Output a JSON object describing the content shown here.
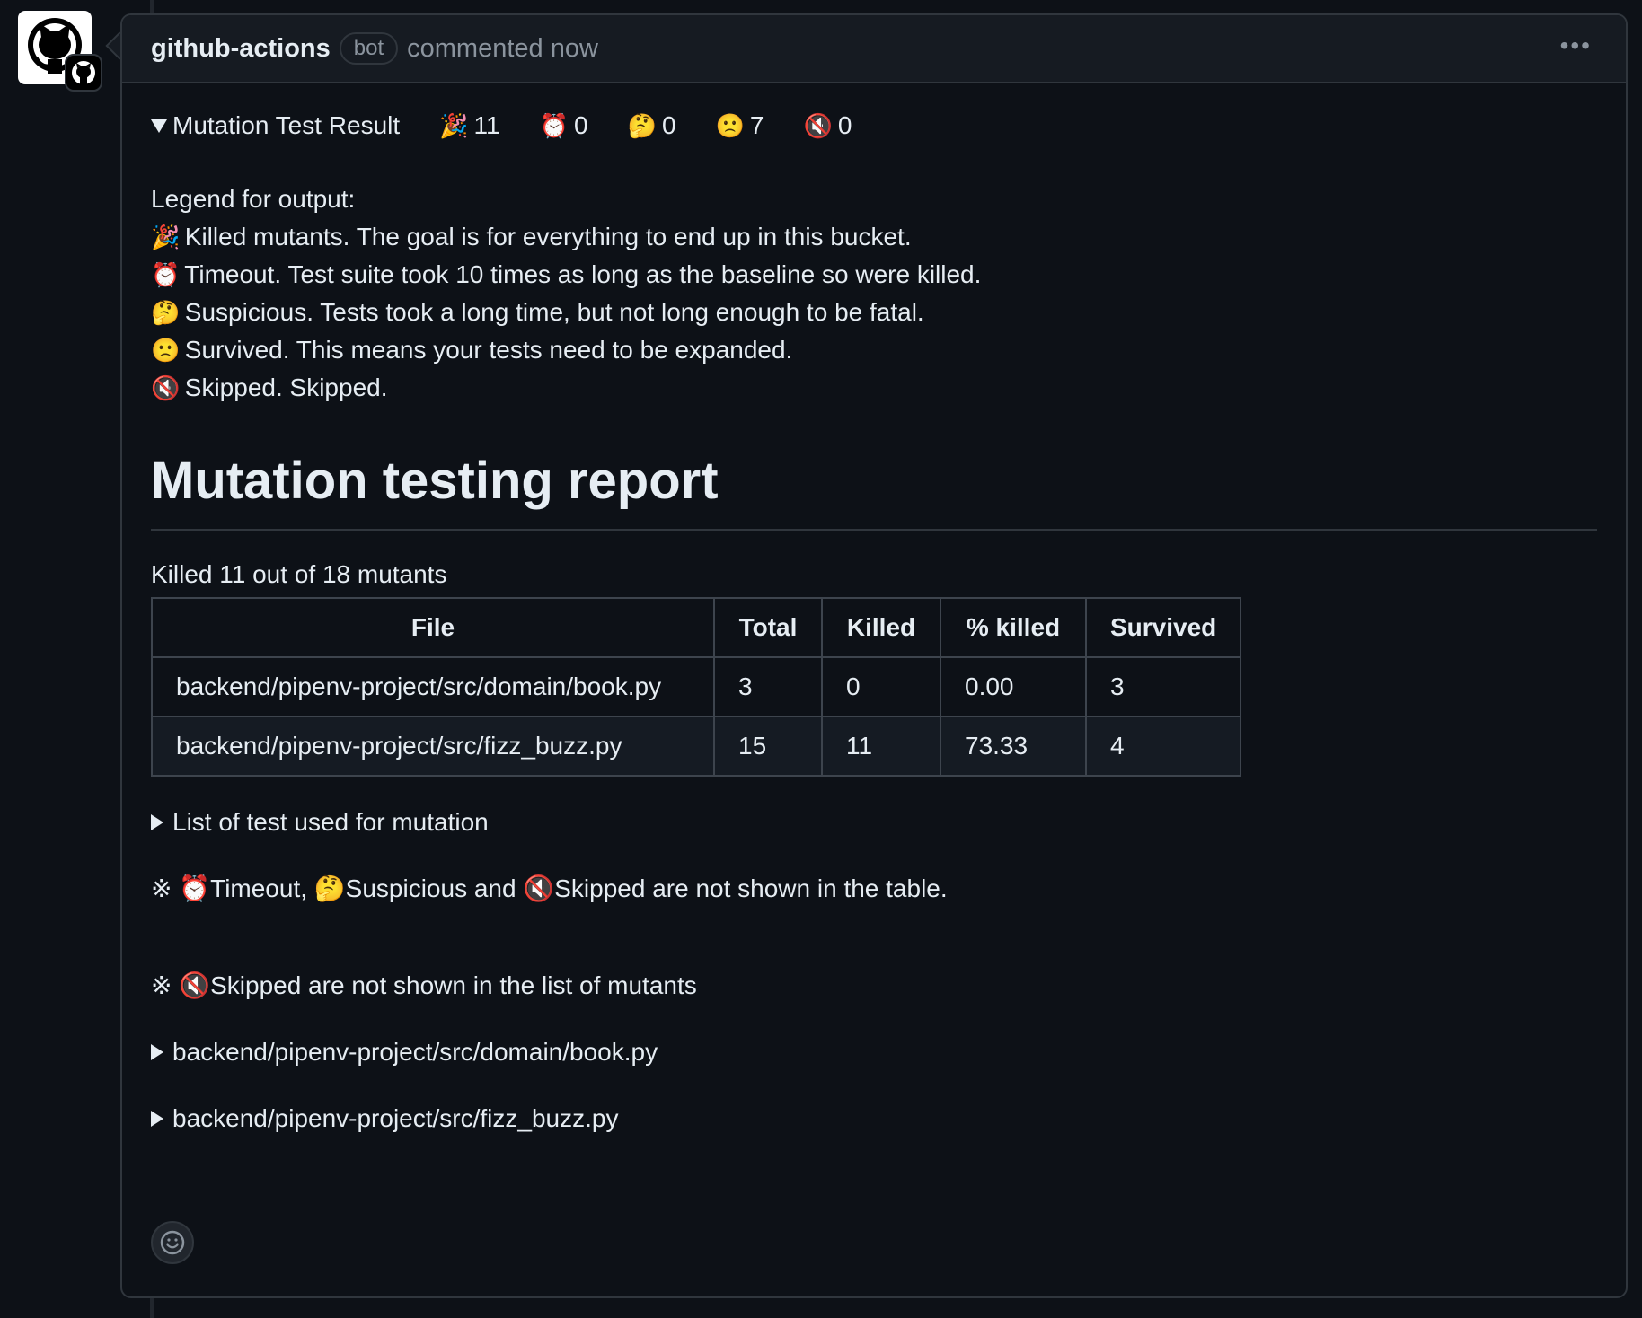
{
  "comment": {
    "author": "github-actions",
    "bot_label": "bot",
    "timestamp": "commented now",
    "menu_icon": "kebab-horizontal-icon"
  },
  "summary": {
    "title": "Mutation Test Result",
    "stats": [
      {
        "icon": "party-popper-icon",
        "emoji": "🎉",
        "value": "11"
      },
      {
        "icon": "alarm-clock-icon",
        "emoji": "⏰",
        "value": "0"
      },
      {
        "icon": "thinking-face-icon",
        "emoji": "🤔",
        "value": "0"
      },
      {
        "icon": "confused-face-icon",
        "emoji": "🙁",
        "value": "7"
      },
      {
        "icon": "muted-speaker-icon",
        "emoji": "🔇",
        "value": "0"
      }
    ]
  },
  "legend": {
    "heading": "Legend for output:",
    "items": [
      {
        "emoji": "🎉",
        "text": "Killed mutants. The goal is for everything to end up in this bucket."
      },
      {
        "emoji": "⏰",
        "text": "Timeout. Test suite took 10 times as long as the baseline so were killed."
      },
      {
        "emoji": "🤔",
        "text": "Suspicious. Tests took a long time, but not long enough to be fatal."
      },
      {
        "emoji": "🙁",
        "text": "Survived. This means your tests need to be expanded."
      },
      {
        "emoji": "🔇",
        "text": "Skipped. Skipped."
      }
    ]
  },
  "report": {
    "title": "Mutation testing report",
    "killed_summary": "Killed 11 out of 18 mutants",
    "columns": [
      "File",
      "Total",
      "Killed",
      "% killed",
      "Survived"
    ],
    "rows": [
      [
        "backend/pipenv-project/src/domain/book.py",
        "3",
        "0",
        "0.00",
        "3"
      ],
      [
        "backend/pipenv-project/src/fizz_buzz.py",
        "15",
        "11",
        "73.33",
        "4"
      ]
    ]
  },
  "test_list_label": "List of test used for mutation",
  "notes": {
    "note1_mark": "※",
    "note1_parts": [
      "⏰",
      "Timeout, ",
      "🤔",
      "Suspicious and ",
      "🔇",
      "Skipped are not shown in the table."
    ],
    "note2_mark": "※",
    "note2_parts": [
      "🔇",
      "Skipped are not shown in the list of mutants"
    ]
  },
  "mutant_files": [
    "backend/pipenv-project/src/domain/book.py",
    "backend/pipenv-project/src/fizz_buzz.py"
  ],
  "colors": {
    "background": "#0d1117",
    "header_bg": "#161b22",
    "border": "#30363d",
    "text": "#e6edf3",
    "muted": "#8b949e"
  }
}
